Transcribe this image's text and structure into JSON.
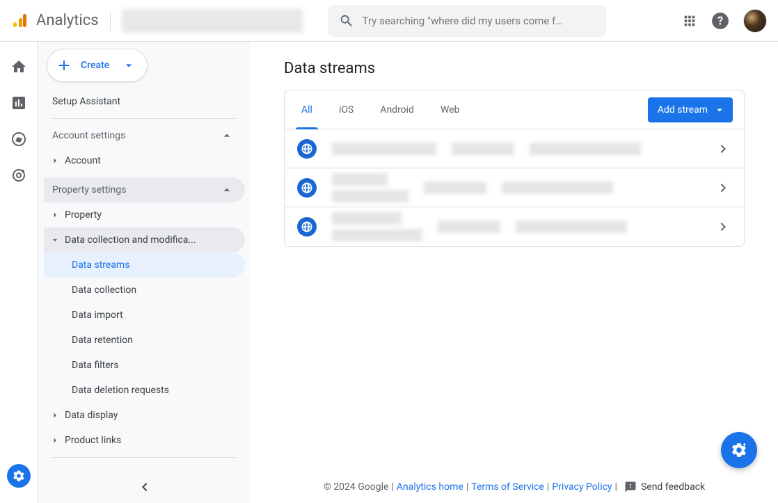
{
  "header": {
    "brand": "Analytics",
    "search_placeholder": "Try searching \"where did my users come f…"
  },
  "sidebar": {
    "create_label": "Create",
    "setup_assistant": "Setup Assistant",
    "account_settings_label": "Account settings",
    "account_item": "Account",
    "property_settings_label": "Property settings",
    "property_item": "Property",
    "data_collection_group": "Data collection and modifica...",
    "leaves": {
      "data_streams": "Data streams",
      "data_collection": "Data collection",
      "data_import": "Data import",
      "data_retention": "Data retention",
      "data_filters": "Data filters",
      "data_deletion": "Data deletion requests"
    },
    "data_display": "Data display",
    "product_links": "Product links"
  },
  "content": {
    "page_title": "Data streams",
    "tabs": {
      "all": "All",
      "ios": "iOS",
      "android": "Android",
      "web": "Web"
    },
    "add_stream_label": "Add stream"
  },
  "footer": {
    "copyright": "© 2024 Google",
    "analytics_home": "Analytics home",
    "tos": "Terms of Service",
    "privacy": "Privacy Policy",
    "feedback": "Send feedback",
    "sep": " | "
  }
}
